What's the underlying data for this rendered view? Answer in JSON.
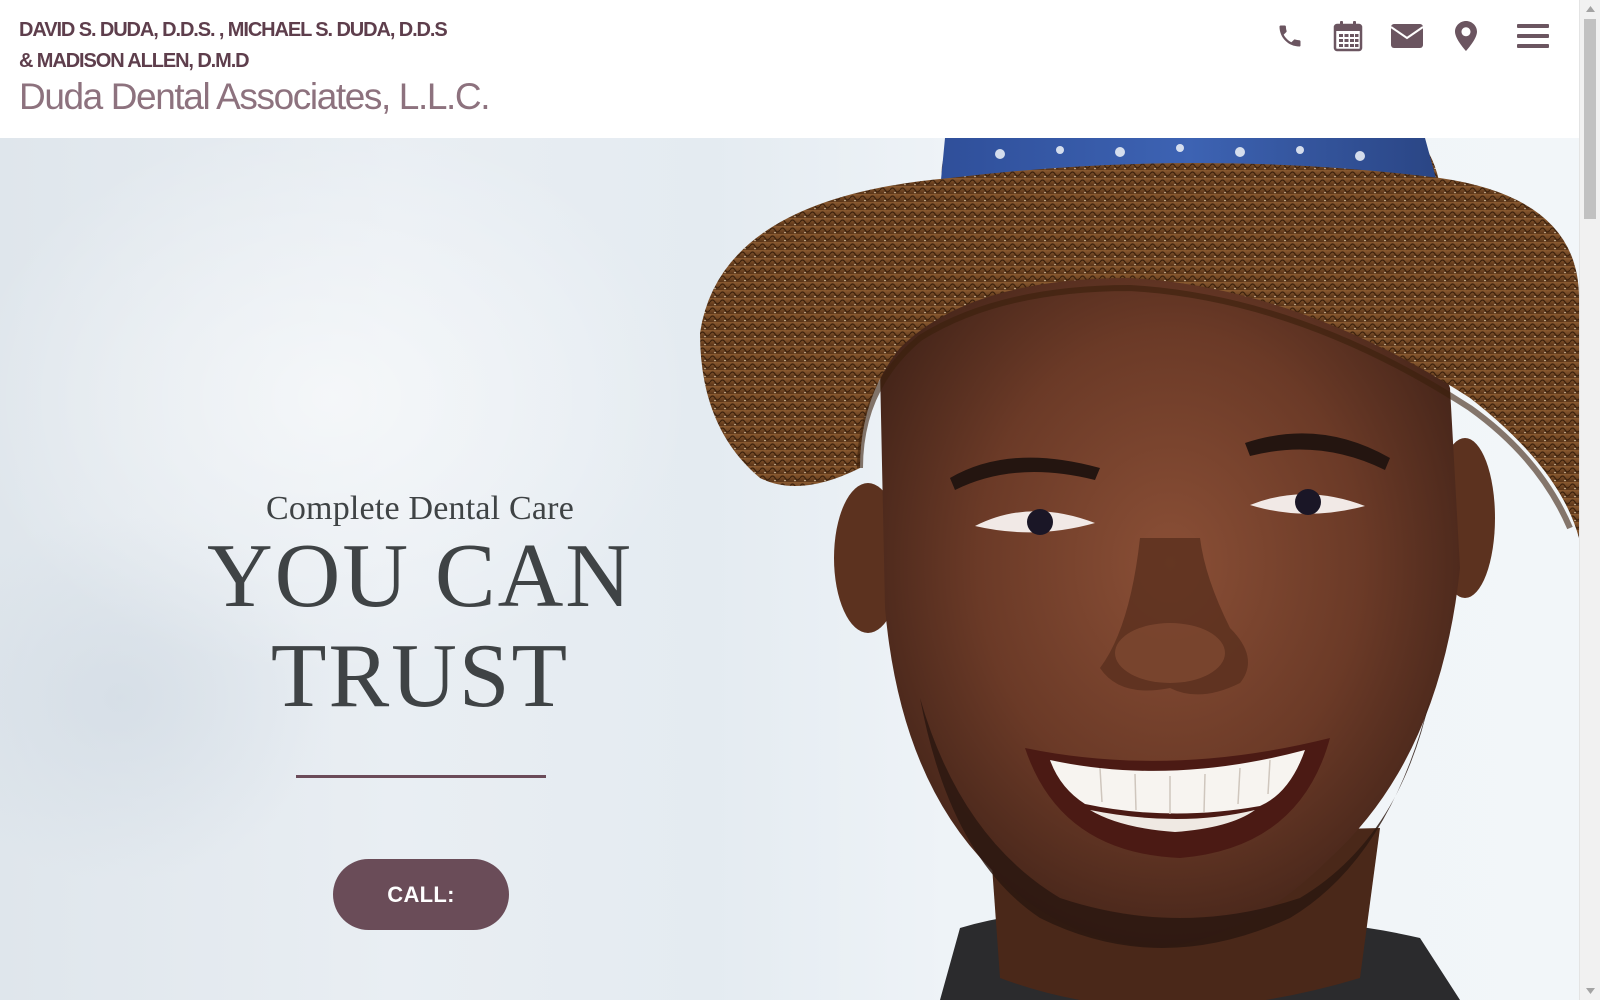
{
  "header": {
    "doctors_line1": "DAVID S. DUDA, D.D.S. , MICHAEL S. DUDA, D.D.S",
    "doctors_line2": "& MADISON ALLEN, D.M.D",
    "practice_name": "Duda Dental Associates, L.L.C.",
    "icons": [
      {
        "name": "phone-icon"
      },
      {
        "name": "calendar-icon"
      },
      {
        "name": "envelope-icon"
      },
      {
        "name": "map-marker-icon"
      },
      {
        "name": "hamburger-menu-icon"
      }
    ]
  },
  "hero": {
    "tagline": "Complete Dental Care",
    "headline_line1": "YOU CAN",
    "headline_line2": "TRUST",
    "call_button_label": "CALL:"
  },
  "colors": {
    "brand": "#6a4c58",
    "brand_light": "#8d727e",
    "heading_text": "#3f4345",
    "header_icon": "#6b5560"
  }
}
